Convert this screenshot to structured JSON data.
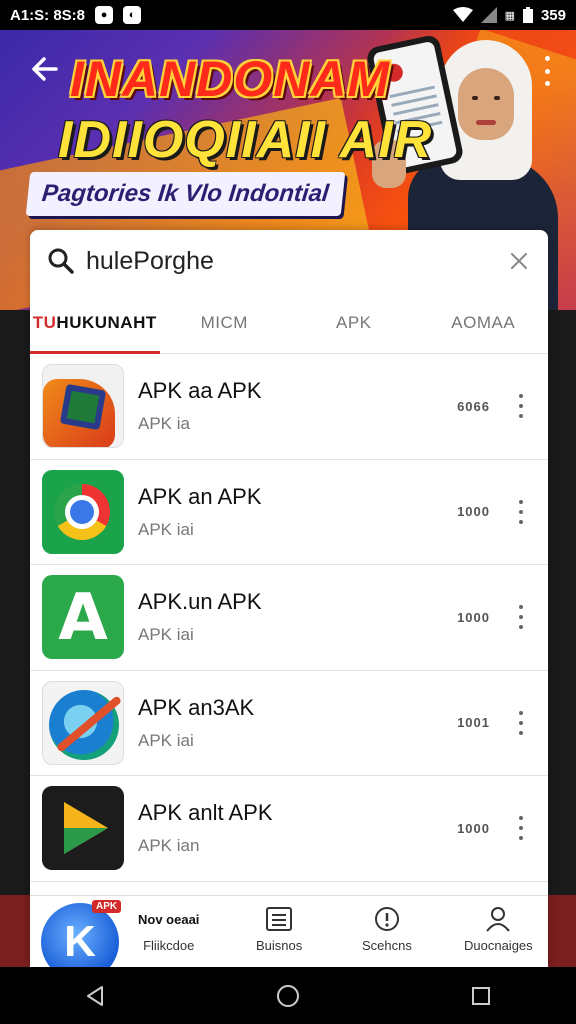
{
  "status_bar": {
    "time_text": "A1:S: 8S:8",
    "right_text": "359"
  },
  "banner": {
    "headline_1": "INANDONAM",
    "headline_2": "IDIIOQIIAII AIR",
    "subtitle": "Pagtories Ik Vlo Indontial"
  },
  "search": {
    "query": "hulePorghe"
  },
  "tabs": [
    {
      "label_red": "TU",
      "label_dark": "HUKUNAHT"
    },
    {
      "label": "MICM"
    },
    {
      "label": "APK"
    },
    {
      "label": "AOMAA"
    }
  ],
  "apps": [
    {
      "title": "APK aa APK",
      "subtitle": "APK ia",
      "count": "6066",
      "icon": "shield-app-icon"
    },
    {
      "title": "APK an APK",
      "subtitle": "APK iai",
      "count": "1000",
      "icon": "chrome-app-icon"
    },
    {
      "title": "APK.un APK",
      "subtitle": "APK iai",
      "count": "1000",
      "icon": "a-letter-app-icon"
    },
    {
      "title": "APK an3AK",
      "subtitle": "APK iai",
      "count": "1001",
      "icon": "compass-app-icon"
    },
    {
      "title": "APK anlt APK",
      "subtitle": "APK ian",
      "count": "1000",
      "icon": "play-app-icon"
    }
  ],
  "bottom_nav": {
    "fab_badge": "APK",
    "items": [
      {
        "top": "Nov oeaai",
        "label": "Fliikcdoe"
      },
      {
        "label": "Buisnos"
      },
      {
        "label": "Scehcns"
      },
      {
        "label": "Duocnaiges"
      }
    ]
  },
  "colors": {
    "accent": "#d42a2a",
    "card_bg": "#ffffff",
    "status_bar_bg": "#000000"
  }
}
